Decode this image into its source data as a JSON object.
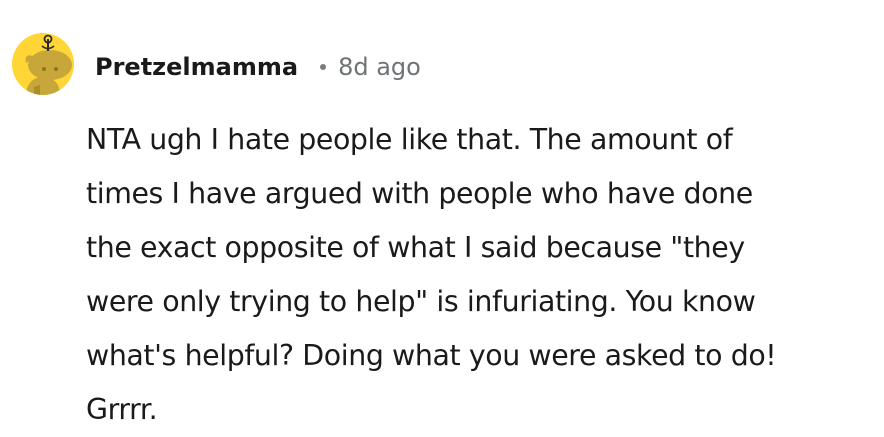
{
  "comment": {
    "author": "Pretzelmamma",
    "time": "8d ago",
    "avatar_icon": "snoo-avatar-icon",
    "avatar_color": "#ffd635",
    "body_lines": [
      "NTA ugh I hate people like that. The amount of",
      "times I have argued with people who have done",
      "the exact opposite of what I said because \"they",
      "were only trying to help\" is infuriating. You know",
      "what's helpful? Doing what you were asked to do!",
      "Grrrr."
    ]
  }
}
